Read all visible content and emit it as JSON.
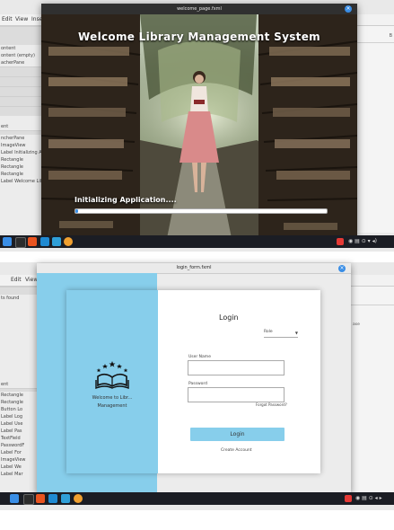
{
  "splash_window": {
    "title": "welcome_page.fxml",
    "heading": "Welcome Library Management System",
    "status_text": "Initializing Application....",
    "progress_fraction": 0.01
  },
  "ide_top": {
    "menu": [
      "Edit",
      "View",
      "Inse"
    ],
    "hierarchy_items": [
      "ontent",
      "ontent (empty)",
      "acherPane"
    ],
    "hierarchy_items_lower": [
      "ent",
      "ncherPane",
      "ImageView",
      "Label Initializing Ap",
      "Rectangle",
      "Rectangle",
      "Rectangle",
      "Label Welcome Lib"
    ],
    "right_label": "B"
  },
  "ide_bottom": {
    "menu": [
      "Edit",
      "View"
    ],
    "left_top_items": [
      "ts found"
    ],
    "left_items": [
      "ent",
      "Rectangle",
      "Rectangle",
      "Button Lo",
      "Label Log",
      "Label Use",
      "Label Pas",
      "TextField",
      "PasswordF",
      "Label For",
      "ImageView",
      "Label We",
      "Label Mar"
    ],
    "right_label": "ase"
  },
  "login_window": {
    "title": "login_form.fxml",
    "welcome_text": "Welcome to Libr...",
    "management_text": "Management",
    "login_heading": "Login",
    "role_label": "Role",
    "username_label": "User Name",
    "password_label": "Password",
    "forgot_text": "Forgot Password?",
    "login_button": "Login",
    "create_account": "Create Account"
  },
  "colors": {
    "accent": "#87ceeb",
    "close": "#3a8ee6",
    "taskbar": "#1b1d24"
  },
  "taskbar_icons": [
    "files-icon",
    "terminal-icon",
    "ubuntu-software-icon",
    "vscode-icon",
    "monitor-icon",
    "firefox-icon"
  ],
  "tray_icons": [
    "record-icon",
    "wifi-icon",
    "volume-icon",
    "power-icon"
  ]
}
